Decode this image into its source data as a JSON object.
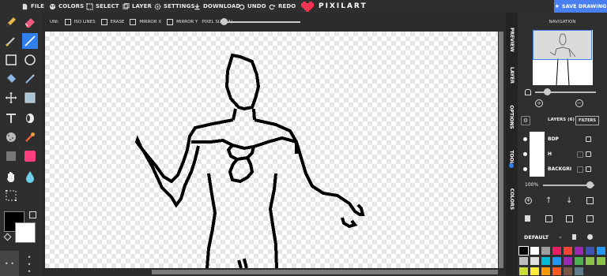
{
  "topbar": {
    "menu": [
      {
        "label": "FILE",
        "icon": "file-icon"
      },
      {
        "label": "COLORS",
        "icon": "palette-icon"
      },
      {
        "label": "SELECT",
        "icon": "select-icon"
      },
      {
        "label": "LAYER",
        "icon": "layer-icon"
      },
      {
        "label": "SETTINGS",
        "icon": "gear-icon"
      },
      {
        "label": "DOWNLOAD",
        "icon": "download-icon"
      },
      {
        "label": "UNDO",
        "icon": "undo-icon"
      },
      {
        "label": "REDO",
        "icon": "redo-icon"
      }
    ],
    "logo": "PIXILART",
    "save_label": "SAVE DRAWING"
  },
  "options": {
    "uni": "UNI:",
    "iso": "ISO LINES",
    "erase": "ERASE",
    "mirror_x": "MIRROR X",
    "mirror_y": "MIRROR Y",
    "pixel_size": "PIXEL SIZE (1)"
  },
  "tools": [
    "pencil-icon",
    "eraser-icon",
    "brush-icon",
    "line-icon",
    "rectangle-icon",
    "circle-icon",
    "bucket-icon",
    "pen-icon",
    "move-icon",
    "square-icon",
    "text-icon",
    "dither-icon",
    "spray-icon",
    "eyedropper-icon",
    "gradient-icon",
    "pink-swatch-icon",
    "hand-icon",
    "droplet-icon",
    "select-area-icon"
  ],
  "sidetabs": [
    "PREVIEW",
    "LAYER",
    "OPTIONS",
    "TOOL",
    "COLORS"
  ],
  "navigation": {
    "title": "NAVIGATION"
  },
  "layers": {
    "title": "LAYERS (6)",
    "filters": "FILTERS",
    "items": [
      {
        "name": "BDP"
      },
      {
        "name": "H"
      },
      {
        "name": "BACKGRI"
      }
    ],
    "opacity": "100%"
  },
  "palette": {
    "name": "DEFAULT",
    "colors": [
      "#000000",
      "#ffffff",
      "#9e9e9e",
      "#e91e63",
      "#f44336",
      "#9c27b0",
      "#3f51b5",
      "#2196f3",
      "#bdbdbd",
      "#e0e0e0",
      "#00bcd4",
      "#2196f3",
      "#9c27b0",
      "#4caf50",
      "#8bc34a",
      "#8bc34a",
      "#cddc39",
      "#ffeb3b",
      "#ff9800",
      "#ff5722",
      "#795548",
      "#607d8b"
    ]
  }
}
